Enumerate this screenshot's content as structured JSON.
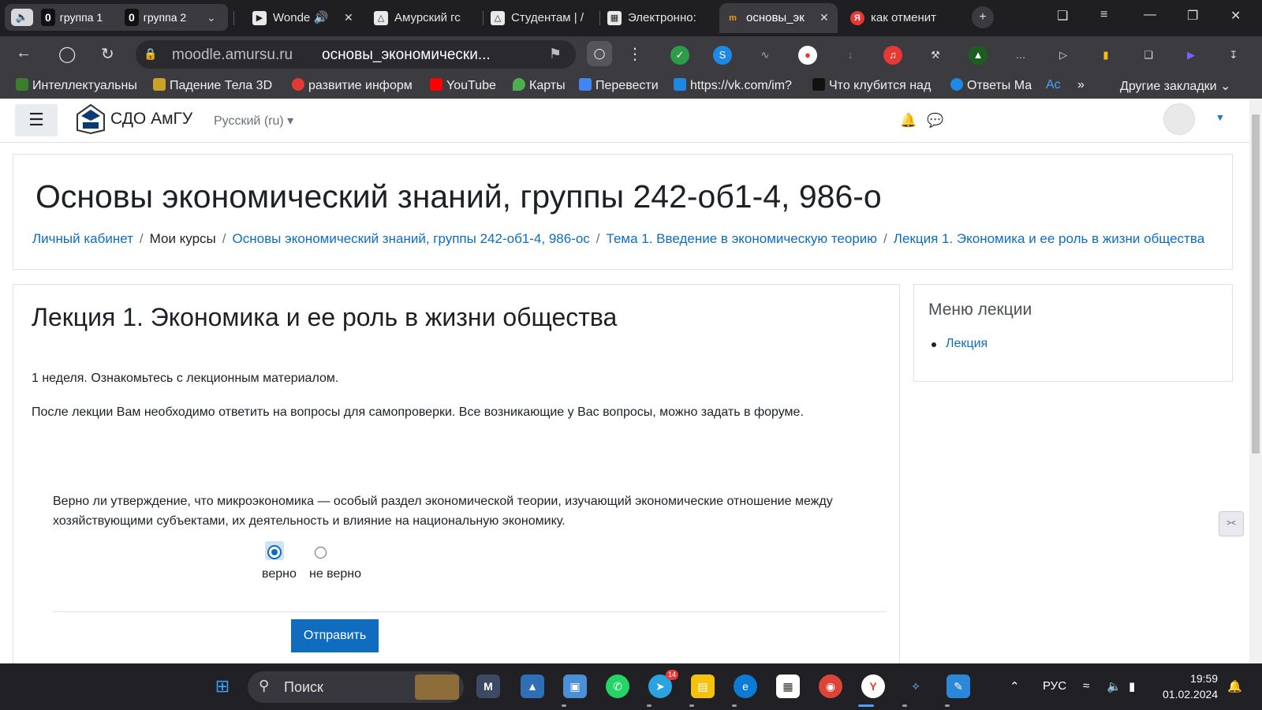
{
  "browser": {
    "groups": [
      {
        "count": "0",
        "label": "группа 1"
      },
      {
        "count": "0",
        "label": "группа 2"
      }
    ],
    "tabs": [
      {
        "title": "Wonde",
        "icon": "play-icon"
      },
      {
        "title": "Амурский гс",
        "icon": "university-icon"
      },
      {
        "title": "Студентам | /",
        "icon": "university-icon"
      },
      {
        "title": "Электронно:",
        "icon": "library-icon"
      },
      {
        "title": "основы_эк",
        "icon": "moodle-icon",
        "active": true
      },
      {
        "title": "как отменит",
        "icon": "yandex-icon"
      }
    ],
    "address": {
      "host": "moodle.amursu.ru",
      "page_title": "основы_экономически..."
    },
    "bookmarks": [
      {
        "label": "Интеллектуальны",
        "color": "#3a7d2c"
      },
      {
        "label": "Падение Тела 3D",
        "color": "#c9a227"
      },
      {
        "label": "развитие информ",
        "color": "#e53935"
      },
      {
        "label": "YouTube",
        "color": "#ff0000"
      },
      {
        "label": "Карты",
        "color": "#4caf50"
      },
      {
        "label": "Перевести",
        "color": "#4285f4"
      },
      {
        "label": "https://vk.com/im?",
        "color": "#1e88e5"
      },
      {
        "label": "Что клубится над",
        "color": "#111111"
      },
      {
        "label": "Ответы Ма",
        "color": "#1e88e5"
      },
      {
        "label": "Ac",
        "color": "#1e88e5"
      },
      {
        "label": "»",
        "color": ""
      }
    ],
    "other_bookmarks": "Другие закладки"
  },
  "moodle": {
    "site_name": "СДО АмГУ",
    "language": "Русский (ru)",
    "course_title": "Основы экономический знаний, группы 242-об1-4, 986-о",
    "breadcrumb": [
      {
        "label": "Личный кабинет",
        "link": true
      },
      {
        "label": "Мои курсы",
        "link": false
      },
      {
        "label": "Основы экономический знаний, группы 242-об1-4, 986-ос",
        "link": true
      },
      {
        "label": "Тема 1. Введение в экономическую теорию",
        "link": true
      },
      {
        "label": "Лекция 1. Экономика и ее роль в жизни общества",
        "link": true
      }
    ],
    "lecture_title": "Лекция 1. Экономика и ее роль в жизни общества",
    "para1": "1 неделя. Ознакомьтесь с лекционным материалом.",
    "para2": "После лекции Вам необходимо ответить на вопросы для самопроверки. Все возникающие у Вас вопросы, можно задать в форуме.",
    "question": "Верно ли утверждение, что микроэкономика — особый раздел экономической теории, изучающий экономические отношение между хозяйствующими субъектами, их деятельность и влияние на национальную экономику.",
    "answers": [
      {
        "label": "верно",
        "checked": true
      },
      {
        "label": "не верно",
        "checked": false
      }
    ],
    "submit_label": "Отправить",
    "sidebar": {
      "title": "Меню лекции",
      "items": [
        "Лекция"
      ]
    }
  },
  "taskbar": {
    "search_placeholder": "Поиск",
    "language": "РУС",
    "time": "19:59",
    "date": "01.02.2024",
    "telegram_badge": "14"
  },
  "colors": {
    "accent": "#0f6cbf",
    "browser_bg": "#3b3b40",
    "taskbar_bg": "#202025"
  }
}
